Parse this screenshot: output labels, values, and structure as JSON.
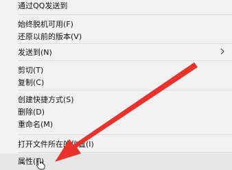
{
  "menu": {
    "items": [
      {
        "label": "通过QQ发送到"
      },
      {
        "label": "始终脱机可用(F)"
      },
      {
        "label": "还原以前的版本(V)"
      },
      {
        "label": "发送到(N)"
      },
      {
        "label": "剪切(T)"
      },
      {
        "label": "复制(C)"
      },
      {
        "label": "创建快捷方式(S)"
      },
      {
        "label": "删除(D)"
      },
      {
        "label": "重命名(M)"
      },
      {
        "label": "打开文件所在的位置(I)"
      },
      {
        "label": "属性(R)"
      }
    ]
  },
  "annotation": {
    "arrow_color": "#e8322c"
  }
}
